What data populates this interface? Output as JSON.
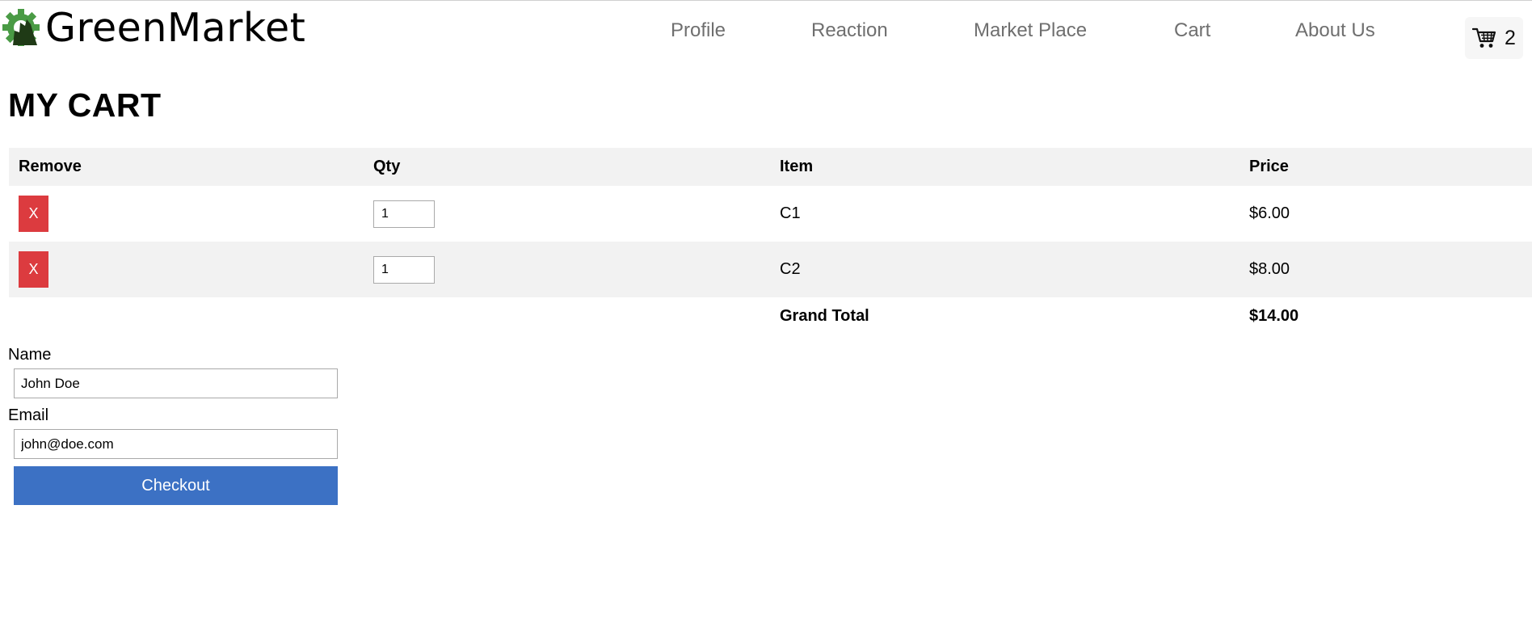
{
  "brand": {
    "name": "GreenMarket",
    "icon": "green-gear-logo-icon",
    "colors": {
      "gear": "#4a9b45",
      "accent": "#1f3a16"
    }
  },
  "nav": {
    "items": [
      {
        "label": "Profile"
      },
      {
        "label": "Reaction"
      },
      {
        "label": "Market Place"
      },
      {
        "label": "Cart"
      },
      {
        "label": "About Us"
      }
    ]
  },
  "cart_widget": {
    "icon": "shopping-cart-icon",
    "count": "2"
  },
  "page": {
    "title": "MY CART"
  },
  "table": {
    "headers": {
      "remove": "Remove",
      "qty": "Qty",
      "item": "Item",
      "price": "Price"
    },
    "rows": [
      {
        "remove_label": "X",
        "qty": "1",
        "item": "C1",
        "price": "$6.00"
      },
      {
        "remove_label": "X",
        "qty": "1",
        "item": "C2",
        "price": "$8.00"
      }
    ],
    "grand_total_label": "Grand Total",
    "grand_total_value": "$14.00"
  },
  "form": {
    "name_label": "Name",
    "name_value": "John Doe",
    "email_label": "Email",
    "email_value": "john@doe.com",
    "checkout_label": "Checkout"
  },
  "colors": {
    "remove_button": "#dc3b3f",
    "checkout_button": "#3c71c4",
    "nav_text": "#6f6f6f",
    "row_stripe": "#f2f2f2"
  }
}
